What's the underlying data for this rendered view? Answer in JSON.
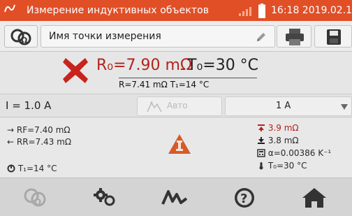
{
  "status_bar": {
    "title": "Измерение индуктивных объектов",
    "clock": "16:18 2019.02.10",
    "icons": [
      "logo-icon",
      "signal-icon",
      "battery-icon"
    ]
  },
  "header": {
    "point_name_placeholder": "Имя точки измерения",
    "icons": [
      "meter-icon",
      "pencil-icon",
      "printer-icon",
      "save-icon"
    ]
  },
  "result": {
    "r0": "R₀=7.90 mΩ",
    "t0": "T₀=30 °C",
    "subline": "R=7.41 mΩ T₁=14 °C",
    "status_icon": "fail-x-icon"
  },
  "controls": {
    "current": "I = 1.0 A",
    "auto_label": "Авто",
    "range_value": "1 A"
  },
  "details": {
    "rf": "RF=7.40 mΩ",
    "rr": "RR=7.43 mΩ",
    "t1": "T₁=14 °C",
    "limit_high": "3.9 mΩ",
    "limit_low": "3.8 mΩ",
    "alpha": "α=0.00386 K⁻¹",
    "t0": "T₀=30 °C",
    "warning_icon": "warning-triangle-icon"
  },
  "toolbar": {
    "items": [
      "meter-icon",
      "settings-icon",
      "waveform-icon",
      "help-icon",
      "home-icon"
    ]
  },
  "colors": {
    "status_bar": "#e14f27",
    "accent_red": "#b3231b",
    "warning_orange": "#d65a2a"
  }
}
